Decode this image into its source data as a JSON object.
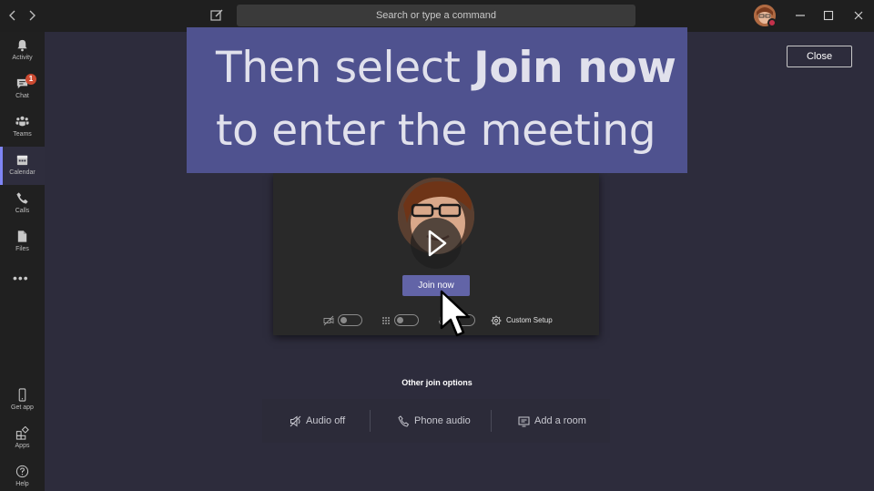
{
  "titlebar": {
    "back_icon": "chevron-left-icon",
    "forward_icon": "chevron-right-icon",
    "compose_icon": "compose-icon",
    "search_placeholder": "Search or type a command"
  },
  "rail": {
    "items": [
      {
        "label": "Activity",
        "icon": "bell-icon"
      },
      {
        "label": "Chat",
        "icon": "chat-icon",
        "badge": "1"
      },
      {
        "label": "Teams",
        "icon": "teams-icon"
      },
      {
        "label": "Calendar",
        "icon": "calendar-icon",
        "active": true
      },
      {
        "label": "Calls",
        "icon": "phone-icon"
      },
      {
        "label": "Files",
        "icon": "file-icon"
      }
    ],
    "more": "•••",
    "bottom_items": [
      {
        "label": "Get app",
        "icon": "mobile-icon"
      },
      {
        "label": "Apps",
        "icon": "apps-icon"
      },
      {
        "label": "Help",
        "icon": "help-icon"
      }
    ]
  },
  "close_label": "Close",
  "banner": {
    "line1_prefix": "Then select ",
    "line1_bold": "Join now",
    "line2": "to enter the meeting"
  },
  "join": {
    "button_label": "Join now",
    "custom_setup": "Custom Setup"
  },
  "other_options": {
    "title": "Other join options",
    "items": [
      {
        "label": "Audio off",
        "icon": "speaker-off-icon"
      },
      {
        "label": "Phone audio",
        "icon": "phone-icon"
      },
      {
        "label": "Add a room",
        "icon": "cast-icon"
      }
    ]
  },
  "colors": {
    "accent": "#6264a7",
    "banner": "#4f528f",
    "badge": "#cc4a31"
  }
}
